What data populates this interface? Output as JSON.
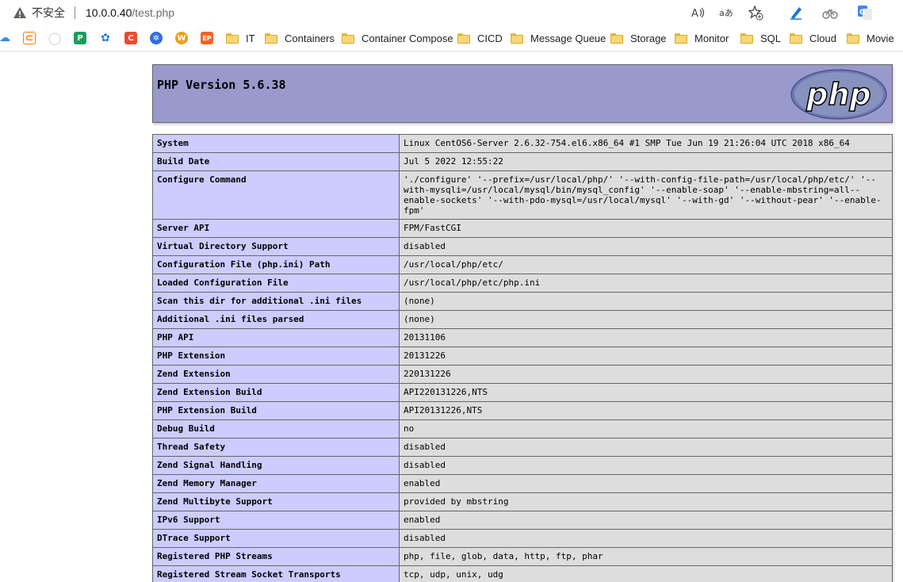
{
  "browser": {
    "security_label": "不安全",
    "url_host": "10.0.0.40",
    "url_path": "/test.php",
    "toolbar_icons": [
      "read-aloud-icon",
      "translate-icon",
      "add-favorite-icon",
      "extension-pen-icon",
      "extension-bike-icon",
      "google-translate-icon"
    ],
    "bookmarks": [
      {
        "type": "icon",
        "name": "cloud-sync-icon",
        "color": "#2d8cf0",
        "glyph": "☁"
      },
      {
        "type": "icon",
        "name": "link-icon",
        "color": "#ff7a00",
        "glyph": "⊂"
      },
      {
        "type": "icon",
        "name": "github-icon",
        "color": "#dddddd",
        "glyph": "○"
      },
      {
        "type": "icon",
        "name": "p-app-icon",
        "color": "#15a05a",
        "glyph": "P"
      },
      {
        "type": "icon",
        "name": "gear-app-icon",
        "color": "#2b7bd6",
        "glyph": "✿"
      },
      {
        "type": "icon",
        "name": "c-app-icon",
        "color": "#ec4c2c",
        "glyph": "C"
      },
      {
        "type": "icon",
        "name": "kubernetes-icon",
        "color": "#326ce5",
        "glyph": "✲"
      },
      {
        "type": "icon",
        "name": "w-app-icon",
        "color": "#f39c12",
        "glyph": "W"
      },
      {
        "type": "icon",
        "name": "ep-app-icon",
        "color": "#f26522",
        "glyph": "EP"
      }
    ],
    "folders": [
      {
        "label": "IT"
      },
      {
        "label": "Containers"
      },
      {
        "label": "Container Compose"
      },
      {
        "label": "CICD"
      },
      {
        "label": "Message Queue"
      },
      {
        "label": "Storage"
      },
      {
        "label": "Monitor"
      },
      {
        "label": "SQL"
      },
      {
        "label": "Cloud"
      },
      {
        "label": "Movie"
      }
    ]
  },
  "phpinfo": {
    "version_title": "PHP Version 5.6.38",
    "logo_text": "php",
    "colors": {
      "header_bg": "#9999cc",
      "key_bg": "#ccccff",
      "value_bg": "#dddddd"
    },
    "rows": [
      {
        "key": "System",
        "value": "Linux CentOS6-Server 2.6.32-754.el6.x86_64 #1 SMP Tue Jun 19 21:26:04 UTC 2018 x86_64"
      },
      {
        "key": "Build Date",
        "value": "Jul 5 2022 12:55:22"
      },
      {
        "key": "Configure Command",
        "value": "'./configure' '--prefix=/usr/local/php/' '--with-config-file-path=/usr/local/php/etc/' '--with-mysqli=/usr/local/mysql/bin/mysql_config' '--enable-soap' '--enable-mbstring=all--enable-sockets' '--with-pdo-mysql=/usr/local/mysql' '--with-gd' '--without-pear' '--enable-fpm'"
      },
      {
        "key": "Server API",
        "value": "FPM/FastCGI"
      },
      {
        "key": "Virtual Directory Support",
        "value": "disabled"
      },
      {
        "key": "Configuration File (php.ini) Path",
        "value": "/usr/local/php/etc/"
      },
      {
        "key": "Loaded Configuration File",
        "value": "/usr/local/php/etc/php.ini"
      },
      {
        "key": "Scan this dir for additional .ini files",
        "value": "(none)"
      },
      {
        "key": "Additional .ini files parsed",
        "value": "(none)"
      },
      {
        "key": "PHP API",
        "value": "20131106"
      },
      {
        "key": "PHP Extension",
        "value": "20131226"
      },
      {
        "key": "Zend Extension",
        "value": "220131226"
      },
      {
        "key": "Zend Extension Build",
        "value": "API220131226,NTS"
      },
      {
        "key": "PHP Extension Build",
        "value": "API20131226,NTS"
      },
      {
        "key": "Debug Build",
        "value": "no"
      },
      {
        "key": "Thread Safety",
        "value": "disabled"
      },
      {
        "key": "Zend Signal Handling",
        "value": "disabled"
      },
      {
        "key": "Zend Memory Manager",
        "value": "enabled"
      },
      {
        "key": "Zend Multibyte Support",
        "value": "provided by mbstring"
      },
      {
        "key": "IPv6 Support",
        "value": "enabled"
      },
      {
        "key": "DTrace Support",
        "value": "disabled"
      },
      {
        "key": "Registered PHP Streams",
        "value": "php, file, glob, data, http, ftp, phar"
      },
      {
        "key": "Registered Stream Socket Transports",
        "value": "tcp, udp, unix, udg"
      },
      {
        "key": "",
        "value": ""
      }
    ]
  }
}
